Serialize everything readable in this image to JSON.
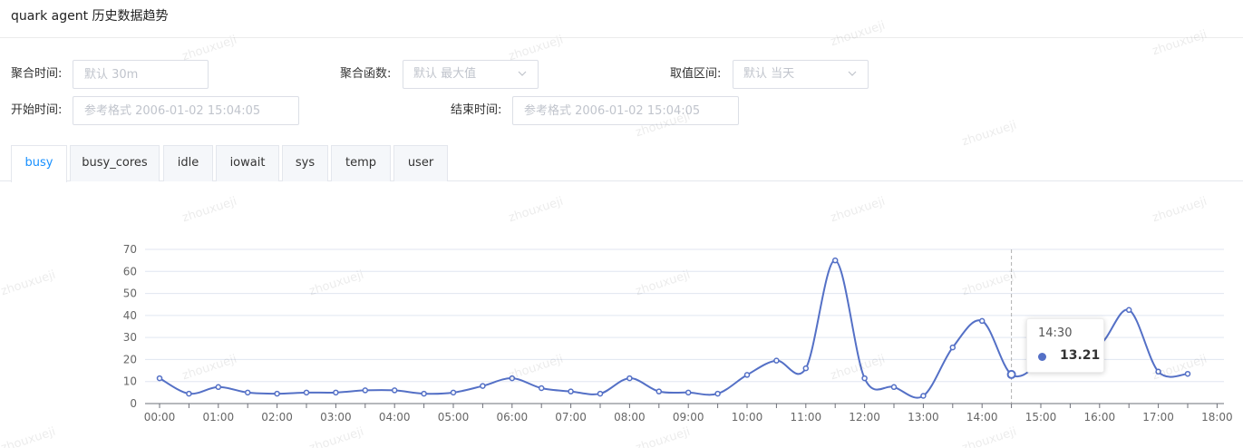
{
  "page": {
    "title": "quark agent 历史数据趋势"
  },
  "filters": {
    "aggregate_time": {
      "label": "聚合时间:",
      "placeholder": "默认 30m"
    },
    "aggregate_func": {
      "label": "聚合函数:",
      "value": "默认 最大值"
    },
    "value_range": {
      "label": "取值区间:",
      "value": "默认 当天"
    },
    "start_time": {
      "label": "开始时间:",
      "placeholder": "参考格式 2006-01-02 15:04:05"
    },
    "end_time": {
      "label": "结束时间:",
      "placeholder": "参考格式 2006-01-02 15:04:05"
    }
  },
  "tabs": [
    {
      "label": "busy",
      "active": true
    },
    {
      "label": "busy_cores",
      "active": false
    },
    {
      "label": "idle",
      "active": false
    },
    {
      "label": "iowait",
      "active": false
    },
    {
      "label": "sys",
      "active": false
    },
    {
      "label": "temp",
      "active": false
    },
    {
      "label": "user",
      "active": false
    }
  ],
  "watermark": "zhouxueji",
  "tooltip": {
    "time": "14:30",
    "value": "13.21"
  },
  "colors": {
    "series": "#5470c6",
    "accent": "#1890ff"
  },
  "chart_data": {
    "type": "line",
    "x": [
      "00:00",
      "00:30",
      "01:00",
      "01:30",
      "02:00",
      "02:30",
      "03:00",
      "03:30",
      "04:00",
      "04:30",
      "05:00",
      "05:30",
      "06:00",
      "06:30",
      "07:00",
      "07:30",
      "08:00",
      "08:30",
      "09:00",
      "09:30",
      "10:00",
      "10:30",
      "11:00",
      "11:30",
      "12:00",
      "12:30",
      "13:00",
      "13:30",
      "14:00",
      "14:30",
      "15:00",
      "15:30",
      "16:00",
      "16:30",
      "17:00",
      "17:30",
      "18:00"
    ],
    "values": [
      11.5,
      4.5,
      7.5,
      5,
      4.5,
      5,
      5,
      6,
      6,
      4.5,
      5,
      8,
      11.5,
      7,
      5.5,
      4.5,
      11.5,
      5.5,
      5,
      4.5,
      13,
      19.5,
      16,
      65,
      11.5,
      7.5,
      3.5,
      25.5,
      37.5,
      13.21,
      19,
      33,
      27,
      42.5,
      14.5,
      13.5
    ],
    "ylim": [
      0,
      70
    ],
    "yticks": [
      0,
      10,
      20,
      30,
      40,
      50,
      60,
      70
    ],
    "xtick_labels": [
      "00:00",
      "01:00",
      "02:00",
      "03:00",
      "04:00",
      "05:00",
      "06:00",
      "07:00",
      "08:00",
      "09:00",
      "10:00",
      "11:00",
      "12:00",
      "13:00",
      "14:00",
      "15:00",
      "16:00",
      "17:00",
      "18:00"
    ],
    "grid": true,
    "highlight_index": 29,
    "hidden_point_indices": [
      30,
      31
    ]
  }
}
